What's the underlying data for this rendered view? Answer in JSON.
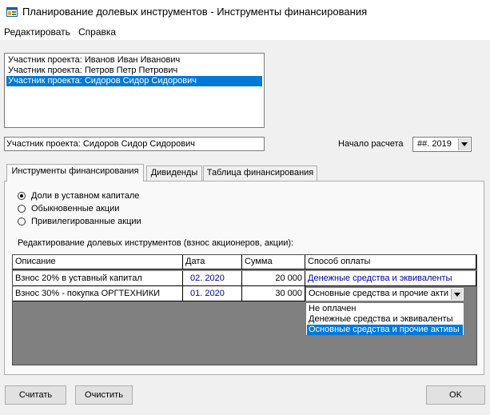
{
  "window": {
    "title": "Планирование долевых инструментов - Инструменты финансирования",
    "icon": "app-window-icon"
  },
  "menu": {
    "items": [
      {
        "label": "Редактировать"
      },
      {
        "label": "Справка"
      }
    ]
  },
  "participants": {
    "items": [
      {
        "label": "Участник проекта: Иванов Иван Иванович",
        "selected": false
      },
      {
        "label": "Участник проекта: Петров Петр Петрович",
        "selected": false
      },
      {
        "label": "Участник проекта: Сидоров Сидор Сидорович",
        "selected": true
      }
    ],
    "current_value": "Участник проекта: Сидоров Сидор Сидорович"
  },
  "calc_start": {
    "label": "Начало расчета",
    "value": "##. 2019"
  },
  "tabs": [
    {
      "label": "Инструменты финансирования",
      "active": true
    },
    {
      "label": "Дивиденды",
      "active": false
    },
    {
      "label": "Таблица финансирования",
      "active": false
    }
  ],
  "instrument_types": {
    "options": [
      {
        "label": "Доли в уставном капитале",
        "checked": true
      },
      {
        "label": "Обыкновенные акции",
        "checked": false
      },
      {
        "label": "Привилегированные акции",
        "checked": false
      }
    ]
  },
  "grid": {
    "caption": "Редактирование долевых инструментов (взнос акционеров, акции):",
    "columns": [
      "Описание",
      "Дата",
      "Сумма",
      "Способ оплаты"
    ],
    "rows": [
      {
        "description": "Взнос 20% в уставный капитал",
        "date": "02. 2020",
        "amount": "20 000",
        "payment": "Денежные средства и эквиваленты"
      },
      {
        "description": "Взнос 30% - покупка ОРГТЕХНИКИ",
        "date": "01. 2020",
        "amount": "30 000",
        "payment": "Основные средства и прочие акти"
      }
    ],
    "payment_dropdown": {
      "options": [
        "Не оплачен",
        "Денежные средства и эквиваленты",
        "Основные средства и прочие активы"
      ],
      "selected_index": 2
    }
  },
  "buttons": {
    "calculate": "Считать",
    "clear": "Очистить",
    "ok": "OK"
  }
}
